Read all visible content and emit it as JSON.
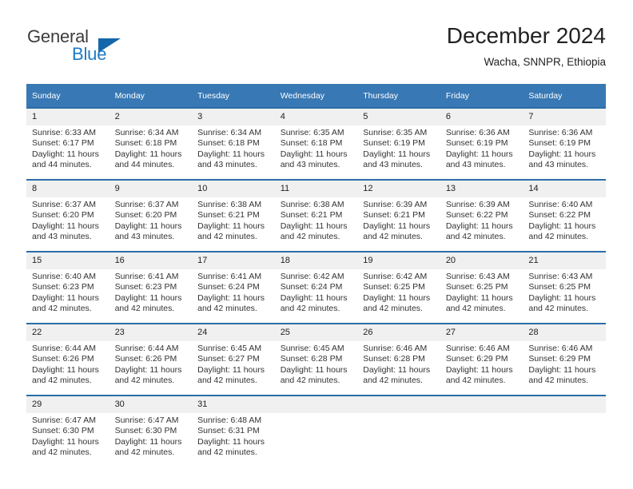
{
  "brand": {
    "name_top": "General",
    "name_bottom": "Blue",
    "accent_color": "#1e7ac4",
    "triangle_color": "#1567ab"
  },
  "header": {
    "title": "December 2024",
    "subtitle": "Wacha, SNNPR, Ethiopia"
  },
  "theme": {
    "header_bg": "#3878b4",
    "row_divider": "#2b6da8",
    "daynum_bg": "#f0f0f0",
    "text": "#333333"
  },
  "weekday_headers": [
    "Sunday",
    "Monday",
    "Tuesday",
    "Wednesday",
    "Thursday",
    "Friday",
    "Saturday"
  ],
  "weeks": [
    [
      {
        "day": "1",
        "sunrise": "Sunrise: 6:33 AM",
        "sunset": "Sunset: 6:17 PM",
        "daylight_1": "Daylight: 11 hours",
        "daylight_2": "and 44 minutes."
      },
      {
        "day": "2",
        "sunrise": "Sunrise: 6:34 AM",
        "sunset": "Sunset: 6:18 PM",
        "daylight_1": "Daylight: 11 hours",
        "daylight_2": "and 44 minutes."
      },
      {
        "day": "3",
        "sunrise": "Sunrise: 6:34 AM",
        "sunset": "Sunset: 6:18 PM",
        "daylight_1": "Daylight: 11 hours",
        "daylight_2": "and 43 minutes."
      },
      {
        "day": "4",
        "sunrise": "Sunrise: 6:35 AM",
        "sunset": "Sunset: 6:18 PM",
        "daylight_1": "Daylight: 11 hours",
        "daylight_2": "and 43 minutes."
      },
      {
        "day": "5",
        "sunrise": "Sunrise: 6:35 AM",
        "sunset": "Sunset: 6:19 PM",
        "daylight_1": "Daylight: 11 hours",
        "daylight_2": "and 43 minutes."
      },
      {
        "day": "6",
        "sunrise": "Sunrise: 6:36 AM",
        "sunset": "Sunset: 6:19 PM",
        "daylight_1": "Daylight: 11 hours",
        "daylight_2": "and 43 minutes."
      },
      {
        "day": "7",
        "sunrise": "Sunrise: 6:36 AM",
        "sunset": "Sunset: 6:19 PM",
        "daylight_1": "Daylight: 11 hours",
        "daylight_2": "and 43 minutes."
      }
    ],
    [
      {
        "day": "8",
        "sunrise": "Sunrise: 6:37 AM",
        "sunset": "Sunset: 6:20 PM",
        "daylight_1": "Daylight: 11 hours",
        "daylight_2": "and 43 minutes."
      },
      {
        "day": "9",
        "sunrise": "Sunrise: 6:37 AM",
        "sunset": "Sunset: 6:20 PM",
        "daylight_1": "Daylight: 11 hours",
        "daylight_2": "and 43 minutes."
      },
      {
        "day": "10",
        "sunrise": "Sunrise: 6:38 AM",
        "sunset": "Sunset: 6:21 PM",
        "daylight_1": "Daylight: 11 hours",
        "daylight_2": "and 42 minutes."
      },
      {
        "day": "11",
        "sunrise": "Sunrise: 6:38 AM",
        "sunset": "Sunset: 6:21 PM",
        "daylight_1": "Daylight: 11 hours",
        "daylight_2": "and 42 minutes."
      },
      {
        "day": "12",
        "sunrise": "Sunrise: 6:39 AM",
        "sunset": "Sunset: 6:21 PM",
        "daylight_1": "Daylight: 11 hours",
        "daylight_2": "and 42 minutes."
      },
      {
        "day": "13",
        "sunrise": "Sunrise: 6:39 AM",
        "sunset": "Sunset: 6:22 PM",
        "daylight_1": "Daylight: 11 hours",
        "daylight_2": "and 42 minutes."
      },
      {
        "day": "14",
        "sunrise": "Sunrise: 6:40 AM",
        "sunset": "Sunset: 6:22 PM",
        "daylight_1": "Daylight: 11 hours",
        "daylight_2": "and 42 minutes."
      }
    ],
    [
      {
        "day": "15",
        "sunrise": "Sunrise: 6:40 AM",
        "sunset": "Sunset: 6:23 PM",
        "daylight_1": "Daylight: 11 hours",
        "daylight_2": "and 42 minutes."
      },
      {
        "day": "16",
        "sunrise": "Sunrise: 6:41 AM",
        "sunset": "Sunset: 6:23 PM",
        "daylight_1": "Daylight: 11 hours",
        "daylight_2": "and 42 minutes."
      },
      {
        "day": "17",
        "sunrise": "Sunrise: 6:41 AM",
        "sunset": "Sunset: 6:24 PM",
        "daylight_1": "Daylight: 11 hours",
        "daylight_2": "and 42 minutes."
      },
      {
        "day": "18",
        "sunrise": "Sunrise: 6:42 AM",
        "sunset": "Sunset: 6:24 PM",
        "daylight_1": "Daylight: 11 hours",
        "daylight_2": "and 42 minutes."
      },
      {
        "day": "19",
        "sunrise": "Sunrise: 6:42 AM",
        "sunset": "Sunset: 6:25 PM",
        "daylight_1": "Daylight: 11 hours",
        "daylight_2": "and 42 minutes."
      },
      {
        "day": "20",
        "sunrise": "Sunrise: 6:43 AM",
        "sunset": "Sunset: 6:25 PM",
        "daylight_1": "Daylight: 11 hours",
        "daylight_2": "and 42 minutes."
      },
      {
        "day": "21",
        "sunrise": "Sunrise: 6:43 AM",
        "sunset": "Sunset: 6:25 PM",
        "daylight_1": "Daylight: 11 hours",
        "daylight_2": "and 42 minutes."
      }
    ],
    [
      {
        "day": "22",
        "sunrise": "Sunrise: 6:44 AM",
        "sunset": "Sunset: 6:26 PM",
        "daylight_1": "Daylight: 11 hours",
        "daylight_2": "and 42 minutes."
      },
      {
        "day": "23",
        "sunrise": "Sunrise: 6:44 AM",
        "sunset": "Sunset: 6:26 PM",
        "daylight_1": "Daylight: 11 hours",
        "daylight_2": "and 42 minutes."
      },
      {
        "day": "24",
        "sunrise": "Sunrise: 6:45 AM",
        "sunset": "Sunset: 6:27 PM",
        "daylight_1": "Daylight: 11 hours",
        "daylight_2": "and 42 minutes."
      },
      {
        "day": "25",
        "sunrise": "Sunrise: 6:45 AM",
        "sunset": "Sunset: 6:28 PM",
        "daylight_1": "Daylight: 11 hours",
        "daylight_2": "and 42 minutes."
      },
      {
        "day": "26",
        "sunrise": "Sunrise: 6:46 AM",
        "sunset": "Sunset: 6:28 PM",
        "daylight_1": "Daylight: 11 hours",
        "daylight_2": "and 42 minutes."
      },
      {
        "day": "27",
        "sunrise": "Sunrise: 6:46 AM",
        "sunset": "Sunset: 6:29 PM",
        "daylight_1": "Daylight: 11 hours",
        "daylight_2": "and 42 minutes."
      },
      {
        "day": "28",
        "sunrise": "Sunrise: 6:46 AM",
        "sunset": "Sunset: 6:29 PM",
        "daylight_1": "Daylight: 11 hours",
        "daylight_2": "and 42 minutes."
      }
    ],
    [
      {
        "day": "29",
        "sunrise": "Sunrise: 6:47 AM",
        "sunset": "Sunset: 6:30 PM",
        "daylight_1": "Daylight: 11 hours",
        "daylight_2": "and 42 minutes."
      },
      {
        "day": "30",
        "sunrise": "Sunrise: 6:47 AM",
        "sunset": "Sunset: 6:30 PM",
        "daylight_1": "Daylight: 11 hours",
        "daylight_2": "and 42 minutes."
      },
      {
        "day": "31",
        "sunrise": "Sunrise: 6:48 AM",
        "sunset": "Sunset: 6:31 PM",
        "daylight_1": "Daylight: 11 hours",
        "daylight_2": "and 42 minutes."
      },
      {
        "day": "",
        "sunrise": "",
        "sunset": "",
        "daylight_1": "",
        "daylight_2": ""
      },
      {
        "day": "",
        "sunrise": "",
        "sunset": "",
        "daylight_1": "",
        "daylight_2": ""
      },
      {
        "day": "",
        "sunrise": "",
        "sunset": "",
        "daylight_1": "",
        "daylight_2": ""
      },
      {
        "day": "",
        "sunrise": "",
        "sunset": "",
        "daylight_1": "",
        "daylight_2": ""
      }
    ]
  ]
}
